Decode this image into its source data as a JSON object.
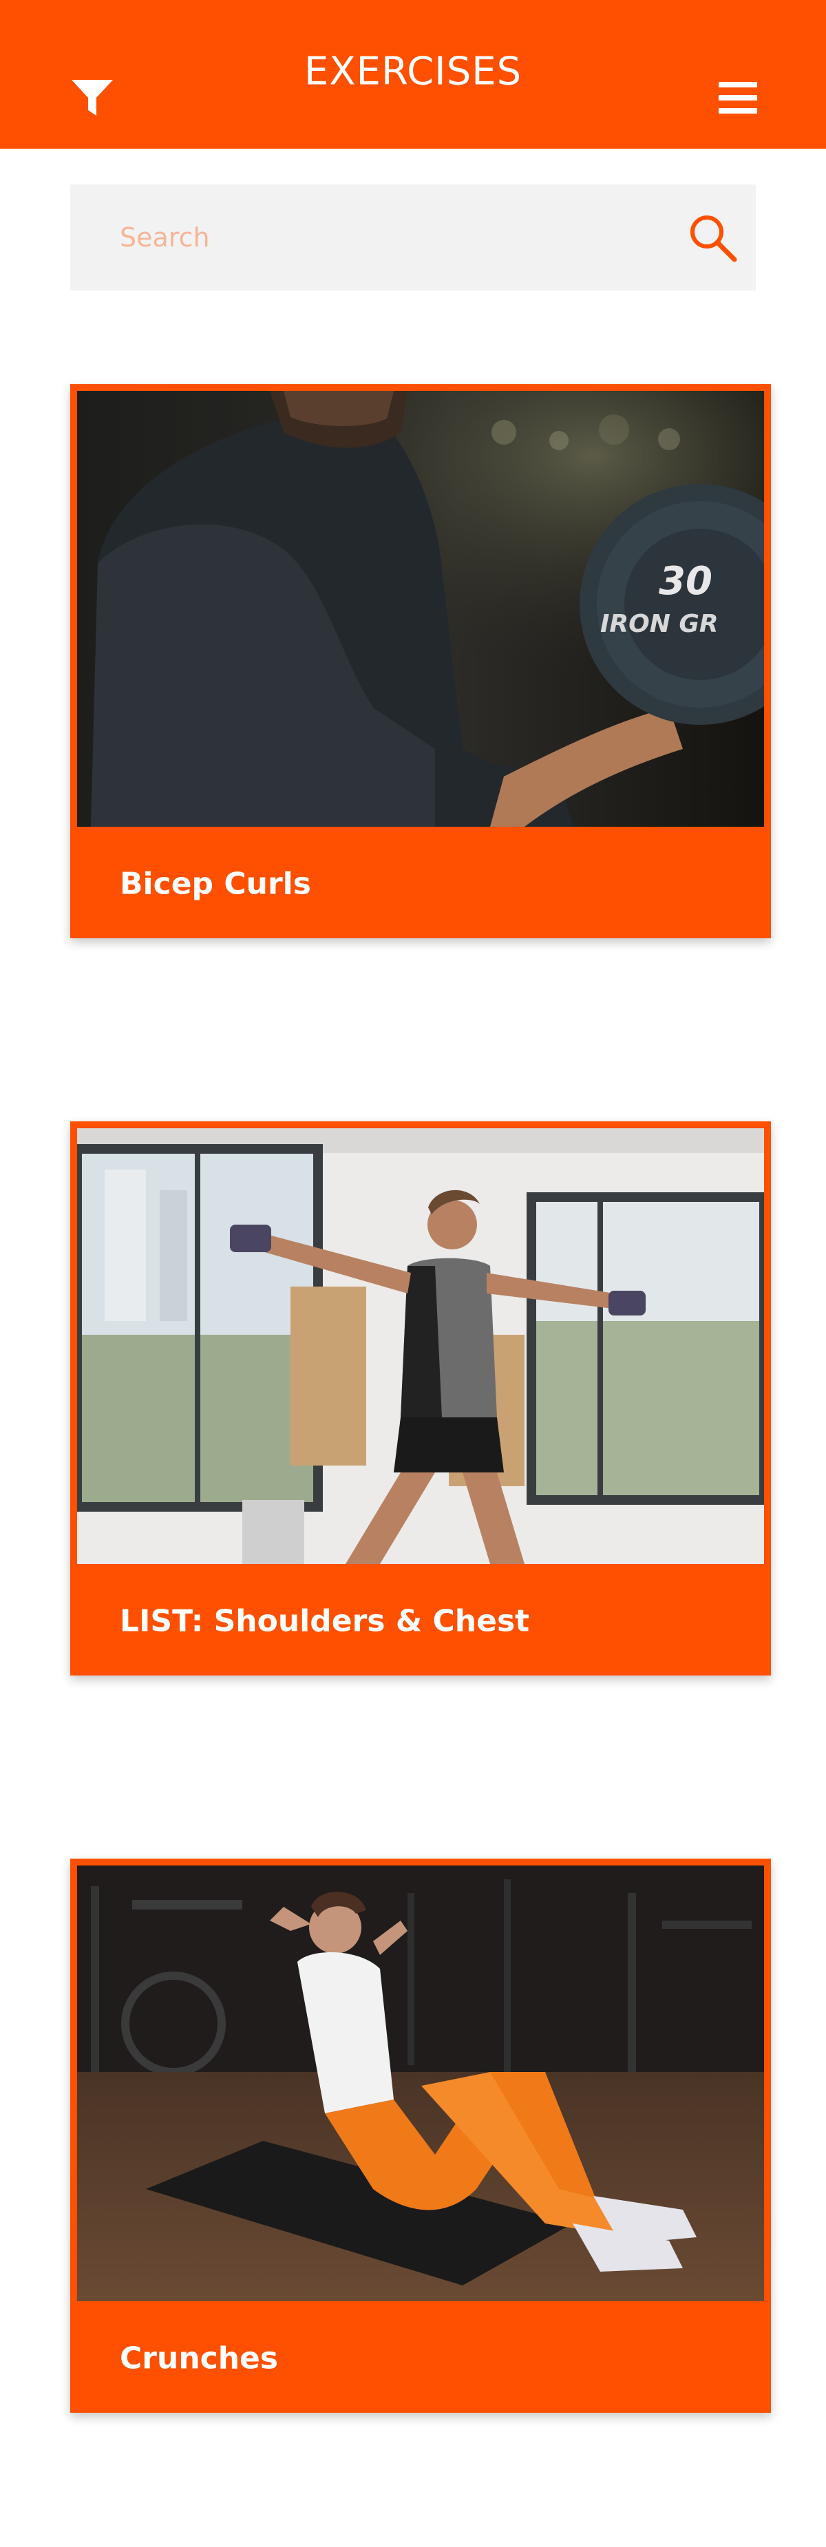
{
  "header": {
    "title": "EXERCISES",
    "filter_icon": "filter-icon",
    "menu_icon": "hamburger-menu-icon"
  },
  "search": {
    "placeholder": "Search",
    "value": "",
    "icon": "search-icon"
  },
  "exercises": [
    {
      "label": "Bicep Curls",
      "image": "man-doing-bicep-curl-with-dumbbell"
    },
    {
      "label": "LIST: Shoulders & Chest",
      "image": "woman-doing-lateral-raise-with-dumbbells"
    },
    {
      "label": "Crunches",
      "image": "woman-doing-crunches-on-mat"
    }
  ],
  "colors": {
    "brand": "#fe5000",
    "search_bg": "#f2f2f2",
    "placeholder": "#f6b597",
    "header_text": "#ffffff"
  }
}
